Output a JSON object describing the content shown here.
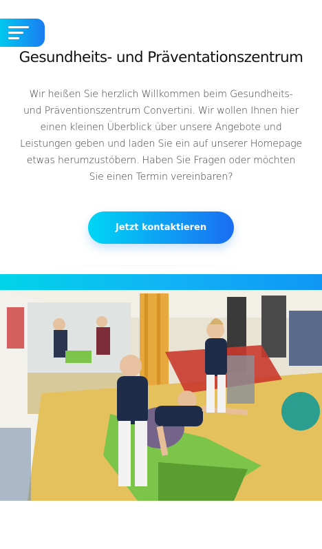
{
  "header": {
    "menu_icon": "hamburger-menu-icon",
    "accent_start": "#00c8f0",
    "accent_end": "#1a7cf2"
  },
  "main": {
    "title": "Gesundheits- und Präventationszentrum",
    "intro": "Wir heißen Sie herzlich Willkommen beim Gesundheits- und Präventionszentrum Convertini. Wir wollen Ihnen hier einen kleinen Überblick über unsere Angebote und Leistungen geben und laden Sie ein auf unserer Homepage etwas herumzustöbern. Haben Sie Fragen oder möchten Sie einen Termin vereinbaren?",
    "cta_label": "Jetzt kontaktieren"
  }
}
